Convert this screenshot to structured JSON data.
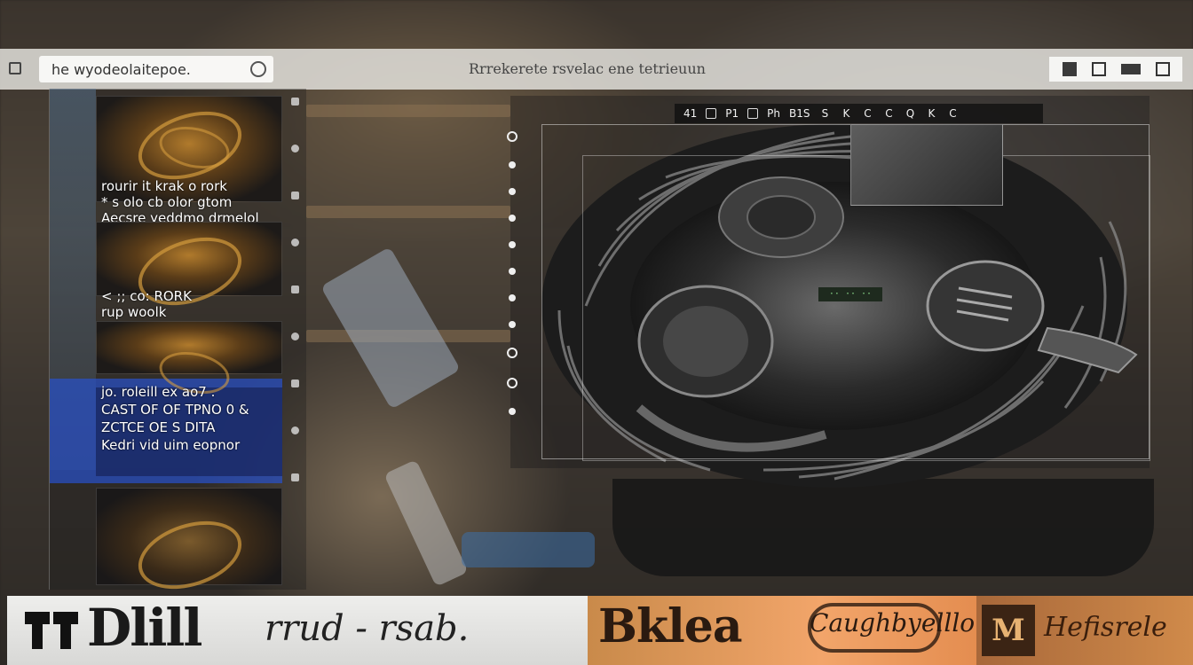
{
  "topbar": {
    "search_text": "he wyodeolaitepoe.",
    "title": "Rrrekerete rsvelac ene tetrieuun",
    "controls": [
      "minimize",
      "restore",
      "maximize",
      "close"
    ]
  },
  "left_panel": {
    "item1": {
      "line1": "rourir it krak o rork",
      "line2": "* s olo cb olor gtom",
      "line3": "Aecsre yeddmo drmelol"
    },
    "item2": {
      "line1": "< ;; co: RORK",
      "line2": "rup woolk"
    },
    "item3": {
      "line1": "jo. roleill ex ao7 .",
      "line2": "CAST OF OF TPNO 0 &",
      "line3": "ZCTCE OE S DITA",
      "line4": "Kedri vid uim eopnor"
    }
  },
  "viewer": {
    "toolbar": [
      "41",
      "P1",
      "Ph",
      "B1S",
      "S",
      "K",
      "C",
      "C",
      "Q",
      "K",
      "C"
    ],
    "lcd": "·· ·· ··"
  },
  "banner": {
    "seg1_big": "Dlill",
    "seg1_script": "rrud - rsab.",
    "seg2_big": "Bklea",
    "seg2_script": "Caughbyelllo",
    "seg3_mark": "M",
    "seg3_script": "Hefisrele"
  },
  "colors": {
    "blue_selection": "#2850c8",
    "banner_orange": "#f2a56a",
    "banner_gray": "#e2e2e0"
  }
}
